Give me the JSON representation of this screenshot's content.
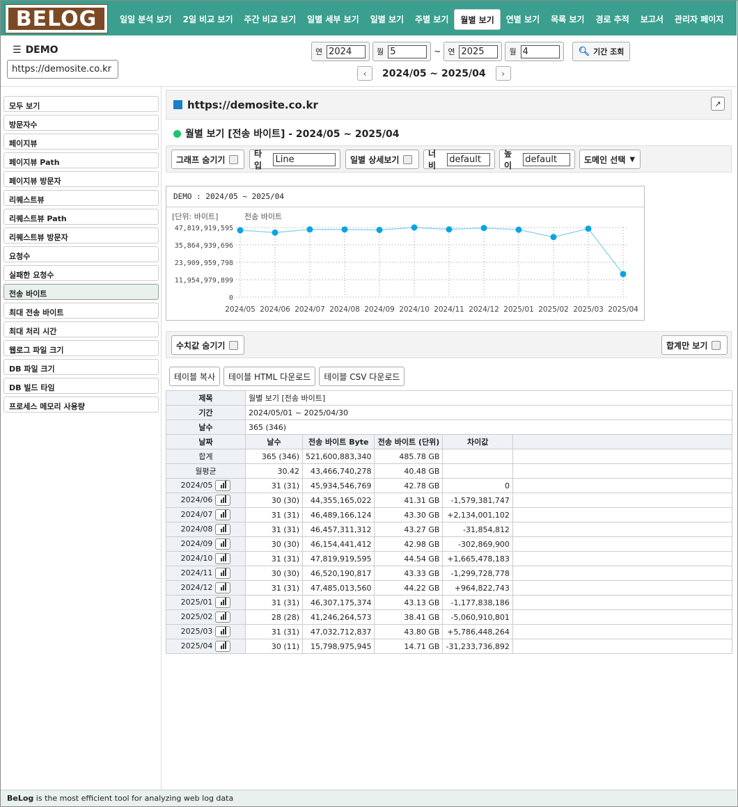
{
  "brand": "BELOG",
  "nav": [
    {
      "label": "일일 분석 보기",
      "active": false
    },
    {
      "label": "2일 비교 보기",
      "active": false
    },
    {
      "label": "주간 비교 보기",
      "active": false
    },
    {
      "label": "일별 세부 보기",
      "active": false
    },
    {
      "label": "일별 보기",
      "active": false
    },
    {
      "label": "주별 보기",
      "active": false
    },
    {
      "label": "월별 보기",
      "active": true
    },
    {
      "label": "연별 보기",
      "active": false
    },
    {
      "label": "목록 보기",
      "active": false
    },
    {
      "label": "경로 추적",
      "active": false
    },
    {
      "label": "보고서",
      "active": false
    },
    {
      "label": "관리자 페이지",
      "active": false
    }
  ],
  "header": {
    "site_name": "DEMO",
    "site_url": "https://demosite.co.kr"
  },
  "period": {
    "year_label": "연",
    "month_label": "월",
    "start_year": "2024",
    "start_month": "5",
    "end_year": "2025",
    "end_month": "4",
    "tilde": "~",
    "search_label": "기간 조회",
    "range_text": "2024/05 ~ 2025/04",
    "prev": "‹",
    "next": "›"
  },
  "sidebar": [
    {
      "label": "모두 보기",
      "active": false
    },
    {
      "label": "방문자수",
      "active": false
    },
    {
      "label": "페이지뷰",
      "active": false
    },
    {
      "label": "페이지뷰 Path",
      "active": false
    },
    {
      "label": "페이지뷰 방문자",
      "active": false
    },
    {
      "label": "리퀘스트뷰",
      "active": false
    },
    {
      "label": "리퀘스트뷰 Path",
      "active": false
    },
    {
      "label": "리퀘스트뷰 방문자",
      "active": false
    },
    {
      "label": "요청수",
      "active": false
    },
    {
      "label": "실패한 요청수",
      "active": false
    },
    {
      "label": "전송 바이트",
      "active": true
    },
    {
      "label": "최대 전송 바이트",
      "active": false
    },
    {
      "label": "최대 처리 시간",
      "active": false
    },
    {
      "label": "웹로그 파일 크기",
      "active": false
    },
    {
      "label": "DB 파일 크기",
      "active": false
    },
    {
      "label": "DB 빌드 타임",
      "active": false
    },
    {
      "label": "프로세스 메모리 사용량",
      "active": false
    }
  ],
  "main": {
    "url": "https://demosite.co.kr",
    "heading": "월별 보기 [전송 바이트] - 2024/05 ~ 2025/04",
    "options": {
      "hide_graph": "그래프 숨기기",
      "type_label": "타입",
      "type_value": "Line",
      "daily_detail": "일별 상세보기",
      "width_label": "너비",
      "width_value": "default",
      "height_label": "높이",
      "height_value": "default",
      "domain_select": "도메인 선택"
    },
    "hide_values": "수치값 숨기기",
    "total_only": "합계만 보기",
    "buttons": {
      "copy": "테이블 복사",
      "html": "테이블 HTML 다운로드",
      "csv": "테이블 CSV 다운로드"
    }
  },
  "chart_data": {
    "type": "line",
    "title": "DEMO : 2024/05 ~ 2025/04",
    "unit_label": "[단위: 바이트]",
    "series_name": "전송 바이트",
    "categories": [
      "2024/05",
      "2024/06",
      "2024/07",
      "2024/08",
      "2024/09",
      "2024/10",
      "2024/11",
      "2024/12",
      "2025/01",
      "2025/02",
      "2025/03",
      "2025/04"
    ],
    "values": [
      45934546769,
      44355165022,
      46489166124,
      46457311312,
      46154441412,
      47819919595,
      46520190817,
      47485013560,
      46307175374,
      41246264573,
      47032712837,
      15798975945
    ],
    "y_ticks": [
      "47,819,919,595",
      "35,864,939,696",
      "23,909,959,798",
      "11,954,979,899",
      "0"
    ],
    "ylim": [
      0,
      47819919595
    ],
    "color": "#0aa5e0"
  },
  "table": {
    "meta": [
      {
        "key": "제목",
        "value": "월별 보기 [전송 바이트]"
      },
      {
        "key": "기간",
        "value": "2024/05/01 ~ 2025/04/30"
      },
      {
        "key": "날수",
        "value": "365 (346)"
      }
    ],
    "headers": [
      "날짜",
      "날수",
      "전송 바이트 Byte",
      "전송 바이트 (단위)",
      "차이값",
      ""
    ],
    "summary": [
      {
        "label": "합계",
        "days": "365 (346)",
        "bytes": "521,600,883,340",
        "unit": "485.78 GB",
        "diff": ""
      },
      {
        "label": "월평균",
        "days": "30.42",
        "bytes": "43,466,740,278",
        "unit": "40.48 GB",
        "diff": ""
      }
    ],
    "rows": [
      {
        "label": "2024/05",
        "days": "31 (31)",
        "bytes": "45,934,546,769",
        "unit": "42.78 GB",
        "diff": "0"
      },
      {
        "label": "2024/06",
        "days": "30 (30)",
        "bytes": "44,355,165,022",
        "unit": "41.31 GB",
        "diff": "-1,579,381,747"
      },
      {
        "label": "2024/07",
        "days": "31 (31)",
        "bytes": "46,489,166,124",
        "unit": "43.30 GB",
        "diff": "+2,134,001,102"
      },
      {
        "label": "2024/08",
        "days": "31 (31)",
        "bytes": "46,457,311,312",
        "unit": "43.27 GB",
        "diff": "-31,854,812"
      },
      {
        "label": "2024/09",
        "days": "30 (30)",
        "bytes": "46,154,441,412",
        "unit": "42.98 GB",
        "diff": "-302,869,900"
      },
      {
        "label": "2024/10",
        "days": "31 (31)",
        "bytes": "47,819,919,595",
        "unit": "44.54 GB",
        "diff": "+1,665,478,183"
      },
      {
        "label": "2024/11",
        "days": "30 (30)",
        "bytes": "46,520,190,817",
        "unit": "43.33 GB",
        "diff": "-1,299,728,778"
      },
      {
        "label": "2024/12",
        "days": "31 (31)",
        "bytes": "47,485,013,560",
        "unit": "44.22 GB",
        "diff": "+964,822,743"
      },
      {
        "label": "2025/01",
        "days": "31 (31)",
        "bytes": "46,307,175,374",
        "unit": "43.13 GB",
        "diff": "-1,177,838,186"
      },
      {
        "label": "2025/02",
        "days": "28 (28)",
        "bytes": "41,246,264,573",
        "unit": "38.41 GB",
        "diff": "-5,060,910,801"
      },
      {
        "label": "2025/03",
        "days": "31 (31)",
        "bytes": "47,032,712,837",
        "unit": "43.80 GB",
        "diff": "+5,786,448,264"
      },
      {
        "label": "2025/04",
        "days": "30 (11)",
        "bytes": "15,798,975,945",
        "unit": "14.71 GB",
        "diff": "-31,233,736,892"
      }
    ]
  },
  "footer": {
    "brand": "BeLog",
    "text": " is the most efficient tool for analyzing web log data"
  }
}
